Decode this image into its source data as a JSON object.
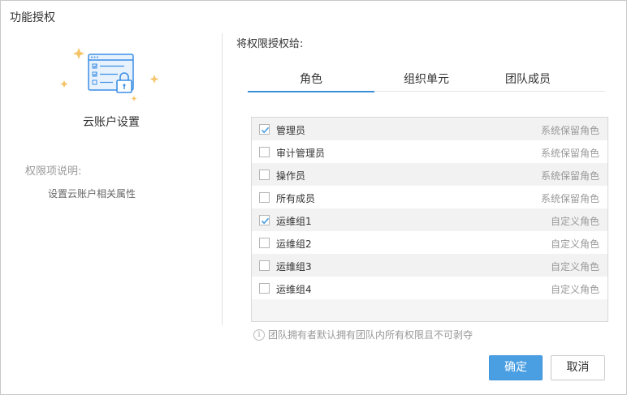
{
  "dialog": {
    "title": "功能授权"
  },
  "left": {
    "setting_name": "云账户设置",
    "desc_title": "权限项说明:",
    "desc_text": "设置云账户相关属性"
  },
  "right": {
    "grant_label": "将权限授权给:",
    "tabs": [
      {
        "label": "角色",
        "active": true
      },
      {
        "label": "组织单元",
        "active": false
      },
      {
        "label": "团队成员",
        "active": false
      }
    ],
    "rows": [
      {
        "name": "管理员",
        "type": "系统保留角色",
        "checked": true
      },
      {
        "name": "审计管理员",
        "type": "系统保留角色",
        "checked": false
      },
      {
        "name": "操作员",
        "type": "系统保留角色",
        "checked": false
      },
      {
        "name": "所有成员",
        "type": "系统保留角色",
        "checked": false
      },
      {
        "name": "运维组1",
        "type": "自定义角色",
        "checked": true
      },
      {
        "name": "运维组2",
        "type": "自定义角色",
        "checked": false
      },
      {
        "name": "运维组3",
        "type": "自定义角色",
        "checked": false
      },
      {
        "name": "运维组4",
        "type": "自定义角色",
        "checked": false
      }
    ],
    "note": "团队拥有者默认拥有团队内所有权限且不可剥夺"
  },
  "buttons": {
    "ok": "确定",
    "cancel": "取消"
  },
  "colors": {
    "accent": "#4a9ee2",
    "tab_underline": "#3b8fd9",
    "icon_blue": "#3a8ee6",
    "sparkle": "#f5c46a"
  },
  "icons": {
    "illustration": "settings-lock-icon",
    "checkbox_check": "check-icon",
    "note": "info-icon"
  }
}
